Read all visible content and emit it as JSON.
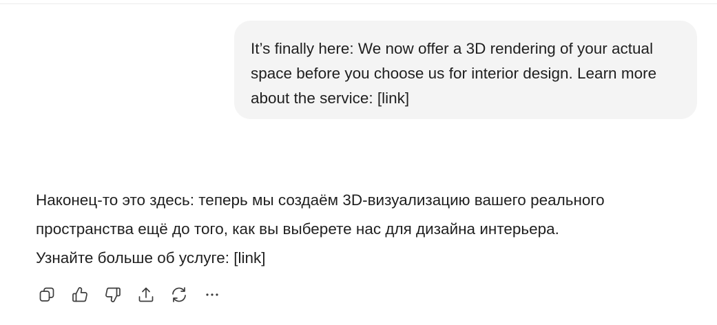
{
  "user_message": {
    "text": "It’s finally here: We now offer a 3D rendering of your actual space before you choose us for interior design. Learn more about the service: [link]"
  },
  "assistant_message": {
    "lines": [
      "Наконец-то это здесь: теперь мы создаём 3D-визуализацию вашего реального",
      "пространства ещё до того, как вы выберете нас для дизайна интерьера.",
      "Узнайте больше об услуге: [link]"
    ]
  },
  "actions": {
    "icons": [
      "copy-icon",
      "thumbs-up-icon",
      "thumbs-down-icon",
      "share-icon",
      "regenerate-icon",
      "more-icon"
    ]
  }
}
